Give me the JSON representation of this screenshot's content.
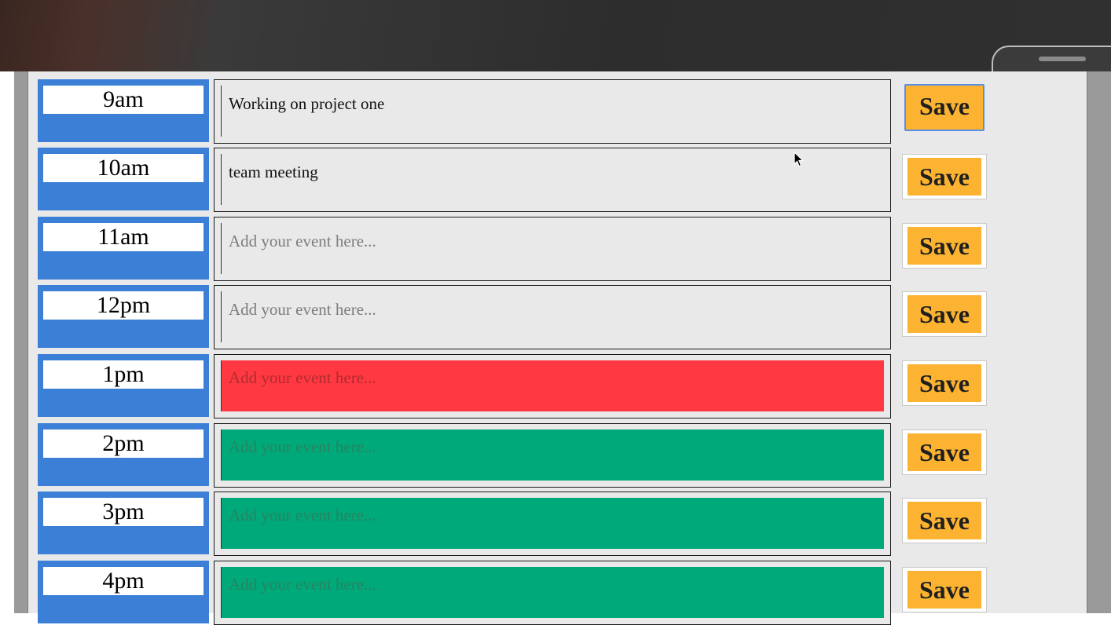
{
  "scheduler": {
    "rows": [
      {
        "hour": "9am",
        "value": "Working on project one",
        "placeholder": "",
        "state": "past"
      },
      {
        "hour": "10am",
        "value": "team meeting",
        "placeholder": "",
        "state": "past"
      },
      {
        "hour": "11am",
        "value": "",
        "placeholder": "Add your event here...",
        "state": "past"
      },
      {
        "hour": "12pm",
        "value": "",
        "placeholder": "Add your event here...",
        "state": "past"
      },
      {
        "hour": "1pm",
        "value": "",
        "placeholder": "Add your event here...",
        "state": "present"
      },
      {
        "hour": "2pm",
        "value": "",
        "placeholder": "Add your event here...",
        "state": "future"
      },
      {
        "hour": "3pm",
        "value": "",
        "placeholder": "Add your event here...",
        "state": "future"
      },
      {
        "hour": "4pm",
        "value": "",
        "placeholder": "Add your event here...",
        "state": "future"
      }
    ],
    "save_label": "Save"
  },
  "colors": {
    "hour_block": "#3b7fd6",
    "past": "#e9e9e9",
    "present": "#ff3842",
    "future": "#00a97a",
    "save_button": "#fbb331",
    "focus_ring": "#5b8ee6"
  },
  "icons": {
    "cursor": "mouse-pointer-icon"
  }
}
